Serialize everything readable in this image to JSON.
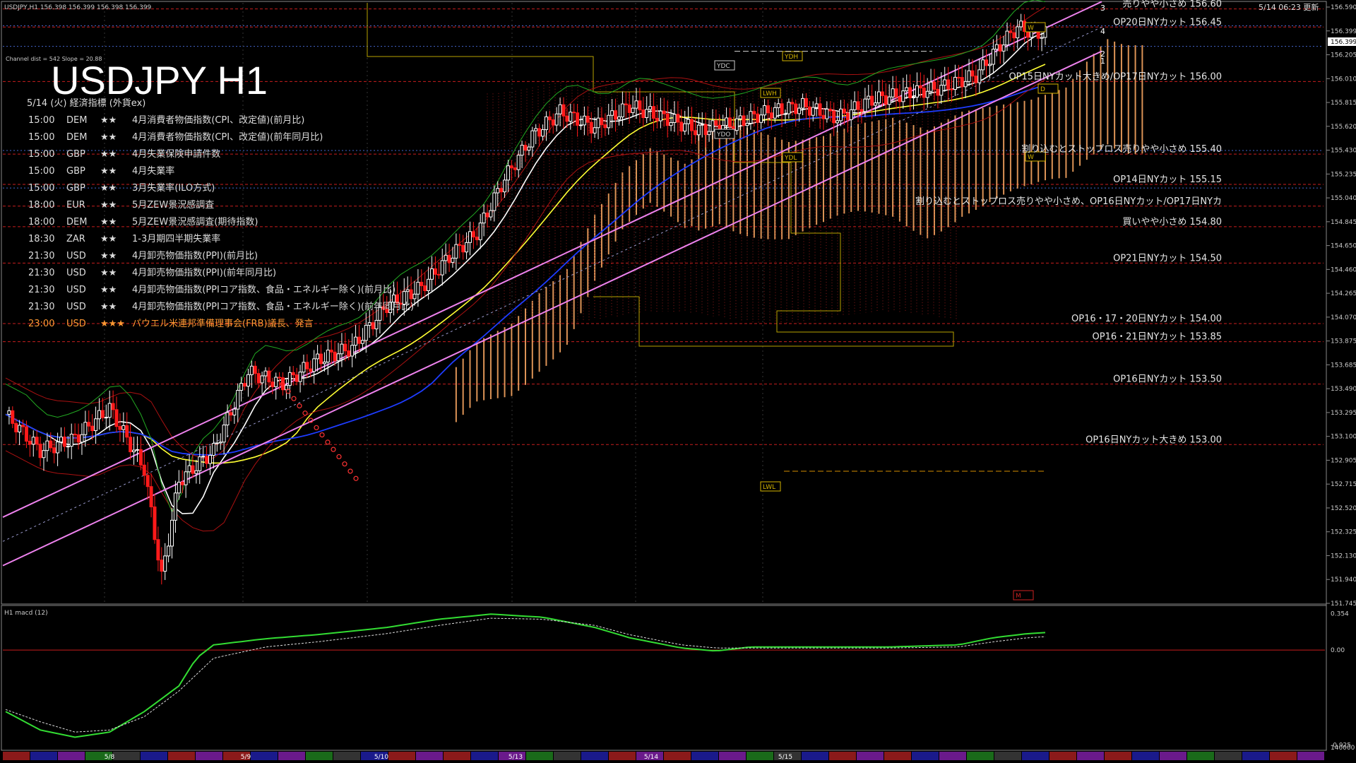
{
  "header": {
    "symbol_line": "USDJPY,H1  156.398 156.399 156.398 156.399",
    "channel_info": "Channel dist = 542 Slope = 20.88",
    "big_title": "USDJPY H1",
    "timestamp": "5/14 06:23 更新",
    "events_heading": "5/14 (火) 経済指標 (外貨ex)"
  },
  "events": [
    {
      "time": "15:00",
      "cur": "DEM",
      "stars": "★★",
      "name": "4月消費者物価指数(CPI、改定値)(前月比)"
    },
    {
      "time": "15:00",
      "cur": "DEM",
      "stars": "★★",
      "name": "4月消費者物価指数(CPI、改定値)(前年同月比)"
    },
    {
      "time": "15:00",
      "cur": "GBP",
      "stars": "★★",
      "name": "4月失業保険申請件数"
    },
    {
      "time": "15:00",
      "cur": "GBP",
      "stars": "★★",
      "name": "4月失業率"
    },
    {
      "time": "15:00",
      "cur": "GBP",
      "stars": "★★",
      "name": "3月失業率(ILO方式)"
    },
    {
      "time": "18:00",
      "cur": "EUR",
      "stars": "★★",
      "name": "5月ZEW景況感調査"
    },
    {
      "time": "18:00",
      "cur": "DEM",
      "stars": "★★",
      "name": "5月ZEW景況感調査(期待指数)"
    },
    {
      "time": "18:30",
      "cur": "ZAR",
      "stars": "★★",
      "name": "1-3月期四半期失業率"
    },
    {
      "time": "21:30",
      "cur": "USD",
      "stars": "★★",
      "name": "4月卸売物価指数(PPI)(前月比)"
    },
    {
      "time": "21:30",
      "cur": "USD",
      "stars": "★★",
      "name": "4月卸売物価指数(PPI)(前年同月比)"
    },
    {
      "time": "21:30",
      "cur": "USD",
      "stars": "★★",
      "name": "4月卸売物価指数(PPIコア指数、食品・エネルギー除く)(前月比)"
    },
    {
      "time": "21:30",
      "cur": "USD",
      "stars": "★★",
      "name": "4月卸売物価指数(PPIコア指数、食品・エネルギー除く)(前年同月比)"
    },
    {
      "time": "23:00",
      "cur": "USD",
      "stars": "★★★",
      "name": "パウエル米連邦準備理事会(FRB)議長、発言"
    }
  ],
  "colors": {
    "background": "#000000",
    "candle_up": "#ffffff",
    "candle_down": "#ff1a1a",
    "channel": "#ee82ee",
    "cloud": "#f4a460",
    "level_line": "#c81e1e",
    "ma_white": "#ffffff",
    "ma_yellow": "#ffff33",
    "ma_blue": "#1e3cff",
    "macd": "#33dd33",
    "signal": "#dddddd",
    "zero": "#c81e1e"
  },
  "labels": {
    "YDH": "YDH",
    "YDC": "YDC",
    "YDO": "YDO",
    "YDL": "YDL",
    "LWH": "LWH",
    "LWL": "LWL",
    "D": "D",
    "W": "W",
    "M": "M",
    "ch1": "1",
    "ch2": "2",
    "ch3": "3",
    "ch4": "4"
  },
  "levels": [
    {
      "text": "売りやや小さめ 156.60",
      "price": 156.6
    },
    {
      "text": "OP20日NYカット 156.45",
      "price": 156.45
    },
    {
      "text": "OP15日NYカット大きめ/OP17日NYカット 156.00",
      "price": 156.0
    },
    {
      "text": "割り込むとストップロス売りやや小さめ 155.40",
      "price": 155.4
    },
    {
      "text": "OP14日NYカット 155.15",
      "price": 155.15
    },
    {
      "text": "割り込むとストップロス売りやや小さめ、OP16日NYカット/OP17日NYカ",
      "price": 154.97
    },
    {
      "text": "買いやや小さめ 154.80",
      "price": 154.8
    },
    {
      "text": "OP21日NYカット 154.50",
      "price": 154.5
    },
    {
      "text": "OP16・17・20日NYカット 154.00",
      "price": 154.0
    },
    {
      "text": "OP16・21日NYカット 153.85",
      "price": 153.85
    },
    {
      "text": "OP16日NYカット 153.50",
      "price": 153.5
    },
    {
      "text": "OP16日NYカット大きめ 153.00",
      "price": 153.0
    }
  ],
  "price_axis": {
    "ticks": [
      "156.590",
      "156.399",
      "156.205",
      "156.010",
      "155.815",
      "155.620",
      "155.430",
      "155.235",
      "155.040",
      "154.845",
      "154.650",
      "154.460",
      "154.265",
      "154.070",
      "153.875",
      "153.685",
      "153.490",
      "153.295",
      "153.100",
      "152.905",
      "152.715",
      "152.520",
      "152.325",
      "152.130",
      "151.940",
      "151.745"
    ],
    "current": "156.399"
  },
  "macd_panel": {
    "label": "H1  macd (12)",
    "ticks": [
      "0.354",
      "0.00",
      "-0.925",
      "140000"
    ]
  },
  "date_labels": [
    "5/8",
    "5/9",
    "5/10",
    "5/13",
    "5/14",
    "5/15"
  ],
  "chart_data": {
    "type": "candlestick",
    "symbol": "USDJPY",
    "timeframe": "H1",
    "ylim": [
      151.7,
      156.65
    ],
    "note_levels": [
      156.6,
      156.45,
      156.0,
      155.4,
      155.15,
      154.97,
      154.8,
      154.5,
      154.0,
      153.85,
      153.5,
      153.0
    ],
    "close_path": [
      [
        0,
        153.25
      ],
      [
        10,
        152.95
      ],
      [
        20,
        153.05
      ],
      [
        30,
        153.3
      ],
      [
        40,
        152.8
      ],
      [
        45,
        151.9
      ],
      [
        50,
        152.7
      ],
      [
        60,
        152.95
      ],
      [
        70,
        153.6
      ],
      [
        80,
        153.5
      ],
      [
        90,
        153.7
      ],
      [
        100,
        153.8
      ],
      [
        110,
        154.15
      ],
      [
        120,
        154.3
      ],
      [
        128,
        154.55
      ],
      [
        136,
        154.75
      ],
      [
        144,
        155.2
      ],
      [
        152,
        155.55
      ],
      [
        160,
        155.75
      ],
      [
        170,
        155.62
      ],
      [
        180,
        155.8
      ],
      [
        190,
        155.7
      ],
      [
        200,
        155.6
      ],
      [
        210,
        155.65
      ],
      [
        220,
        155.75
      ],
      [
        230,
        155.8
      ],
      [
        240,
        155.7
      ],
      [
        250,
        155.85
      ],
      [
        260,
        155.9
      ],
      [
        270,
        155.95
      ],
      [
        280,
        156.05
      ],
      [
        287,
        156.3
      ],
      [
        292,
        156.45
      ],
      [
        297,
        156.4
      ]
    ],
    "macd": [
      [
        0,
        -0.6
      ],
      [
        10,
        -0.78
      ],
      [
        20,
        -0.85
      ],
      [
        30,
        -0.8
      ],
      [
        40,
        -0.6
      ],
      [
        50,
        -0.35
      ],
      [
        55,
        -0.08
      ],
      [
        60,
        0.05
      ],
      [
        75,
        0.11
      ],
      [
        90,
        0.15
      ],
      [
        110,
        0.22
      ],
      [
        125,
        0.3
      ],
      [
        140,
        0.35
      ],
      [
        155,
        0.32
      ],
      [
        170,
        0.22
      ],
      [
        180,
        0.12
      ],
      [
        195,
        0.02
      ],
      [
        205,
        -0.01
      ],
      [
        215,
        0.03
      ],
      [
        235,
        0.03
      ],
      [
        255,
        0.03
      ],
      [
        265,
        0.04
      ],
      [
        275,
        0.05
      ],
      [
        285,
        0.12
      ],
      [
        295,
        0.16
      ],
      [
        300,
        0.17
      ]
    ],
    "signal": [
      [
        0,
        -0.58
      ],
      [
        10,
        -0.7
      ],
      [
        20,
        -0.8
      ],
      [
        30,
        -0.78
      ],
      [
        40,
        -0.65
      ],
      [
        50,
        -0.4
      ],
      [
        60,
        -0.08
      ],
      [
        75,
        0.03
      ],
      [
        90,
        0.08
      ],
      [
        110,
        0.16
      ],
      [
        125,
        0.24
      ],
      [
        140,
        0.31
      ],
      [
        155,
        0.3
      ],
      [
        170,
        0.24
      ],
      [
        180,
        0.15
      ],
      [
        195,
        0.05
      ],
      [
        205,
        0.02
      ],
      [
        225,
        0.02
      ],
      [
        255,
        0.02
      ],
      [
        275,
        0.03
      ],
      [
        285,
        0.08
      ],
      [
        295,
        0.12
      ],
      [
        300,
        0.13
      ]
    ]
  }
}
